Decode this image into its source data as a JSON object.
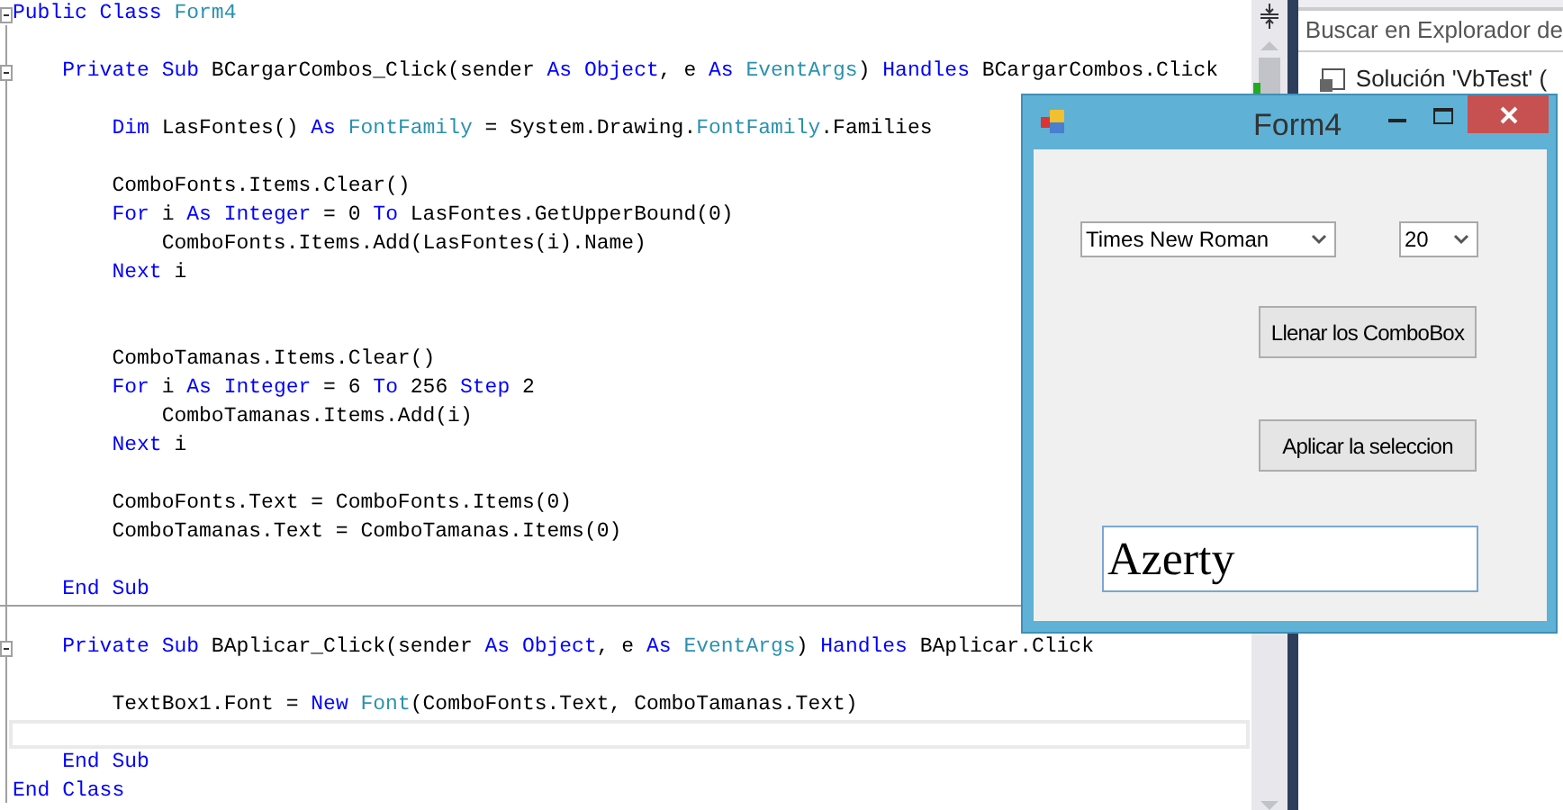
{
  "editor": {
    "lines": [
      {
        "kind": "code",
        "fold": true,
        "separator_above": false,
        "segments": [
          {
            "kind": "kw",
            "text": "Public Class "
          },
          {
            "kind": "type",
            "text": "Form4"
          }
        ]
      },
      {
        "kind": "blank",
        "fold": false,
        "separator_above": false
      },
      {
        "kind": "code",
        "fold": true,
        "separator_above": false,
        "segments": [
          {
            "kind": "kw",
            "text": "    Private Sub "
          },
          {
            "kind": "plain",
            "text": "BCargarCombos_Click(sender "
          },
          {
            "kind": "kw",
            "text": "As Object"
          },
          {
            "kind": "plain",
            "text": ", e "
          },
          {
            "kind": "kw",
            "text": "As "
          },
          {
            "kind": "type",
            "text": "EventArgs"
          },
          {
            "kind": "plain",
            "text": ") "
          },
          {
            "kind": "kw",
            "text": "Handles "
          },
          {
            "kind": "plain",
            "text": "BCargarCombos.Click"
          }
        ]
      },
      {
        "kind": "blank",
        "fold": false,
        "separator_above": false
      },
      {
        "kind": "code",
        "fold": false,
        "separator_above": false,
        "segments": [
          {
            "kind": "kw",
            "text": "        Dim "
          },
          {
            "kind": "plain",
            "text": "LasFontes() "
          },
          {
            "kind": "kw",
            "text": "As "
          },
          {
            "kind": "type",
            "text": "FontFamily"
          },
          {
            "kind": "plain",
            "text": " = System.Drawing."
          },
          {
            "kind": "type",
            "text": "FontFamily"
          },
          {
            "kind": "plain",
            "text": ".Families"
          }
        ]
      },
      {
        "kind": "blank",
        "fold": false,
        "separator_above": false
      },
      {
        "kind": "code",
        "fold": false,
        "separator_above": false,
        "segments": [
          {
            "kind": "plain",
            "text": "        ComboFonts.Items.Clear()"
          }
        ]
      },
      {
        "kind": "code",
        "fold": false,
        "separator_above": false,
        "segments": [
          {
            "kind": "kw",
            "text": "        For "
          },
          {
            "kind": "plain",
            "text": "i "
          },
          {
            "kind": "kw",
            "text": "As Integer"
          },
          {
            "kind": "plain",
            "text": " = 0 "
          },
          {
            "kind": "kw",
            "text": "To "
          },
          {
            "kind": "plain",
            "text": "LasFontes.GetUpperBound(0)"
          }
        ]
      },
      {
        "kind": "code",
        "fold": false,
        "separator_above": false,
        "segments": [
          {
            "kind": "plain",
            "text": "            ComboFonts.Items.Add(LasFontes(i).Name)"
          }
        ]
      },
      {
        "kind": "code",
        "fold": false,
        "separator_above": false,
        "segments": [
          {
            "kind": "kw",
            "text": "        Next "
          },
          {
            "kind": "plain",
            "text": "i"
          }
        ]
      },
      {
        "kind": "blank",
        "fold": false,
        "separator_above": false
      },
      {
        "kind": "blank",
        "fold": false,
        "separator_above": false
      },
      {
        "kind": "code",
        "fold": false,
        "separator_above": false,
        "segments": [
          {
            "kind": "plain",
            "text": "        ComboTamanas.Items.Clear()"
          }
        ]
      },
      {
        "kind": "code",
        "fold": false,
        "separator_above": false,
        "segments": [
          {
            "kind": "kw",
            "text": "        For "
          },
          {
            "kind": "plain",
            "text": "i "
          },
          {
            "kind": "kw",
            "text": "As Integer"
          },
          {
            "kind": "plain",
            "text": " = 6 "
          },
          {
            "kind": "kw",
            "text": "To "
          },
          {
            "kind": "plain",
            "text": "256 "
          },
          {
            "kind": "kw",
            "text": "Step "
          },
          {
            "kind": "plain",
            "text": "2"
          }
        ]
      },
      {
        "kind": "code",
        "fold": false,
        "separator_above": false,
        "segments": [
          {
            "kind": "plain",
            "text": "            ComboTamanas.Items.Add(i)"
          }
        ]
      },
      {
        "kind": "code",
        "fold": false,
        "separator_above": false,
        "segments": [
          {
            "kind": "kw",
            "text": "        Next "
          },
          {
            "kind": "plain",
            "text": "i"
          }
        ]
      },
      {
        "kind": "blank",
        "fold": false,
        "separator_above": false
      },
      {
        "kind": "code",
        "fold": false,
        "separator_above": false,
        "segments": [
          {
            "kind": "plain",
            "text": "        ComboFonts.Text = ComboFonts.Items(0)"
          }
        ]
      },
      {
        "kind": "code",
        "fold": false,
        "separator_above": false,
        "segments": [
          {
            "kind": "plain",
            "text": "        ComboTamanas.Text = ComboTamanas.Items(0)"
          }
        ]
      },
      {
        "kind": "blank",
        "fold": false,
        "separator_above": false
      },
      {
        "kind": "code",
        "fold": false,
        "separator_above": false,
        "segments": [
          {
            "kind": "kw",
            "text": "    End Sub"
          }
        ]
      },
      {
        "kind": "blank",
        "fold": false,
        "separator_above": true
      },
      {
        "kind": "code",
        "fold": true,
        "separator_above": false,
        "segments": [
          {
            "kind": "kw",
            "text": "    Private Sub "
          },
          {
            "kind": "plain",
            "text": "BAplicar_Click(sender "
          },
          {
            "kind": "kw",
            "text": "As Object"
          },
          {
            "kind": "plain",
            "text": ", e "
          },
          {
            "kind": "kw",
            "text": "As "
          },
          {
            "kind": "type",
            "text": "EventArgs"
          },
          {
            "kind": "plain",
            "text": ") "
          },
          {
            "kind": "kw",
            "text": "Handles "
          },
          {
            "kind": "plain",
            "text": "BAplicar.Click"
          }
        ]
      },
      {
        "kind": "blank",
        "fold": false,
        "separator_above": false
      },
      {
        "kind": "code",
        "fold": false,
        "separator_above": false,
        "segments": [
          {
            "kind": "plain",
            "text": "        TextBox1.Font = "
          },
          {
            "kind": "kw",
            "text": "New "
          },
          {
            "kind": "type",
            "text": "Font"
          },
          {
            "kind": "plain",
            "text": "(ComboFonts.Text, ComboTamanas.Text)"
          }
        ]
      },
      {
        "kind": "current",
        "fold": false,
        "separator_above": false
      },
      {
        "kind": "code",
        "fold": false,
        "separator_above": false,
        "segments": [
          {
            "kind": "kw",
            "text": "    End Sub"
          }
        ]
      },
      {
        "kind": "code",
        "fold": false,
        "separator_above": false,
        "segments": [
          {
            "kind": "kw",
            "text": "End Class"
          }
        ]
      }
    ]
  },
  "solution_explorer": {
    "search": {
      "placeholder": "Buscar en Explorador de"
    },
    "items": [
      {
        "label": "Solución 'VbTest' ("
      }
    ]
  },
  "form_window": {
    "title": "Form4",
    "font_combo": {
      "value": "Times New Roman"
    },
    "size_combo": {
      "value": "20"
    },
    "buttons": [
      "Llenar los ComboBox",
      "Aplicar la seleccion"
    ],
    "text_box": {
      "value": "Azerty"
    }
  }
}
